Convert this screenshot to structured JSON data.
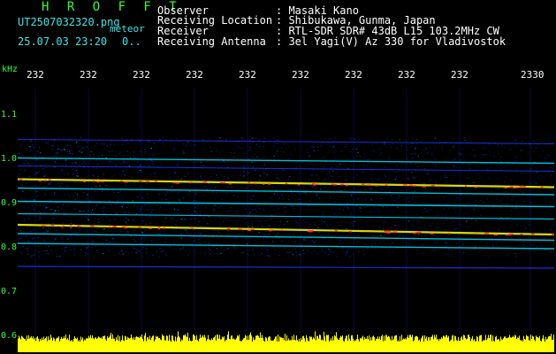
{
  "header": {
    "title": "H R O F F T",
    "filename": "UT2507032320.png",
    "meteor_label": "meteor",
    "date_time": "25.07.03 23:20",
    "meteor_count": "0.."
  },
  "station_info": [
    {
      "label": "Observer",
      "value": ": Masaki Kano"
    },
    {
      "label": "Receiving Location",
      "value": ": Shibukawa, Gunma, Japan"
    },
    {
      "label": "Receiver",
      "value": ": RTL-SDR SDR# 43dB L15 103.2MHz CW"
    },
    {
      "label": "Receiving Antenna",
      "value": ": 3el Yagi(V) Az 330 for Vladivostok"
    }
  ],
  "spectrogram": {
    "frequency_unit": "kHz",
    "y_ticks": [
      "1.1",
      "1.0",
      "0.9",
      "0.8",
      "0.7",
      "0.6"
    ],
    "y_values": [
      1.1,
      1.0,
      0.9,
      0.8,
      0.7,
      0.6
    ],
    "x_ticks": [
      "232",
      "232",
      "232",
      "232",
      "232",
      "232",
      "232",
      "232",
      "232",
      "2330"
    ],
    "colors": {
      "background": "#000000",
      "noise": "#1a3cff",
      "signal_mid": "#00e0ff",
      "signal_high": "#ffff00",
      "signal_peak": "#ff3030",
      "amplitude_bar": "#ffff00",
      "text_green": "#33ff33",
      "text_cyan": "#3ee6e6",
      "text_white": "#ffffff"
    }
  }
}
